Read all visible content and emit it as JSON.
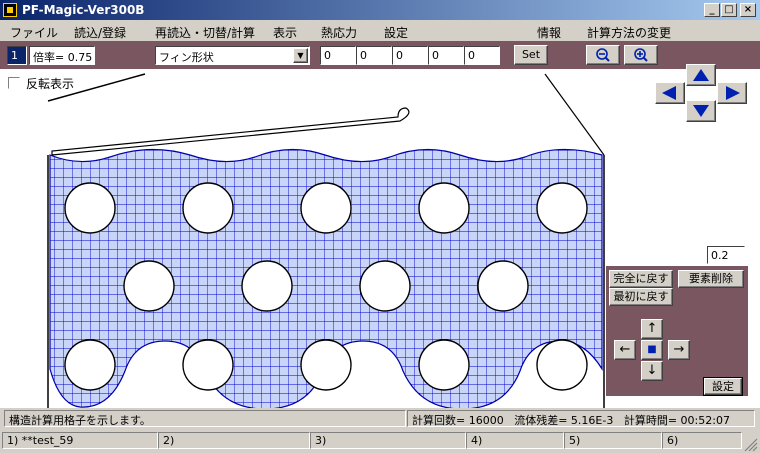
{
  "window": {
    "title": "PF-Magic-Ver300B"
  },
  "menu": [
    "ファイル",
    "読込/登録",
    "再読込・切替/計算",
    "表示",
    "熱応力",
    "設定",
    "情報",
    "計算方法の変更"
  ],
  "toolbar": {
    "index_value": "1",
    "scale_label": "倍率= 0.75",
    "shape_select": "フィン形状",
    "value_fields": [
      "0",
      "0",
      "0",
      "0",
      "0"
    ],
    "set_label": "Set"
  },
  "canvas": {
    "invert_label": "反転表示",
    "step_value": "0.2"
  },
  "right_panel": {
    "reset_all": "完全に戻す",
    "reset_first": "最初に戻す",
    "delete_element": "要素削除",
    "apply": "設定",
    "arrows": {
      "up": "↑",
      "down": "↓",
      "left": "←",
      "right": "→",
      "center": "■"
    }
  },
  "status": {
    "message": "構造計算用格子を示します。",
    "calc_count": "計算回数= 16000",
    "residual": "流体残差= 5.16E-3",
    "calc_time": "計算時間= 00:52:07"
  },
  "tabs": [
    "1) **test_59",
    "2)",
    "3)",
    "4)",
    "5)",
    "6)"
  ],
  "colors": {
    "accent_panel": "#7a5660",
    "mesh_fill": "#c8d4f8",
    "mesh_line": "#0000cc",
    "nav_arrow": "#0020b0"
  }
}
